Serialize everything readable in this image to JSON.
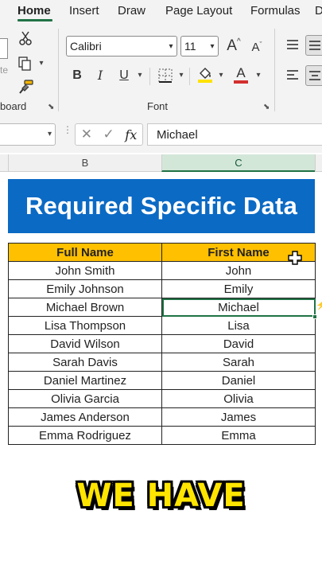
{
  "ribbon": {
    "tabs": [
      "Home",
      "Insert",
      "Draw",
      "Page Layout",
      "Formulas",
      "D"
    ],
    "active_tab": "Home",
    "font": {
      "name": "Calibri",
      "size": "11",
      "group_label": "Font",
      "grow_label": "A",
      "shrink_label": "A",
      "bold_label": "B",
      "italic_label": "I",
      "underline_label": "U",
      "font_color_label": "A"
    },
    "clipboard": {
      "group_label": "board"
    },
    "colors": {
      "accent": "#217346",
      "font_color_bar": "#d32f2f",
      "fill_color_bar": "#ffe200"
    }
  },
  "formula_bar": {
    "name_box_value": "",
    "fx_label": "fx",
    "formula_value": "Michael"
  },
  "columns": {
    "b": "B",
    "c": "C",
    "selected": "C"
  },
  "sheet": {
    "banner_title": "Required Specific Data",
    "banner_color": "#0b6ac4",
    "header_fill": "#ffc000",
    "headers": [
      "Full Name",
      "First Name"
    ],
    "rows": [
      [
        "John Smith",
        "John"
      ],
      [
        "Emily Johnson",
        "Emily"
      ],
      [
        "Michael Brown",
        "Michael"
      ],
      [
        "Lisa Thompson",
        "Lisa"
      ],
      [
        "David Wilson",
        "David"
      ],
      [
        "Sarah Davis",
        "Sarah"
      ],
      [
        "Daniel Martinez",
        "Daniel"
      ],
      [
        "Olivia Garcia",
        "Olivia"
      ],
      [
        "James Anderson",
        "James"
      ],
      [
        "Emma Rodriguez",
        "Emma"
      ]
    ]
  },
  "caption": {
    "text": "WE HAVE",
    "color": "#ffe500"
  }
}
